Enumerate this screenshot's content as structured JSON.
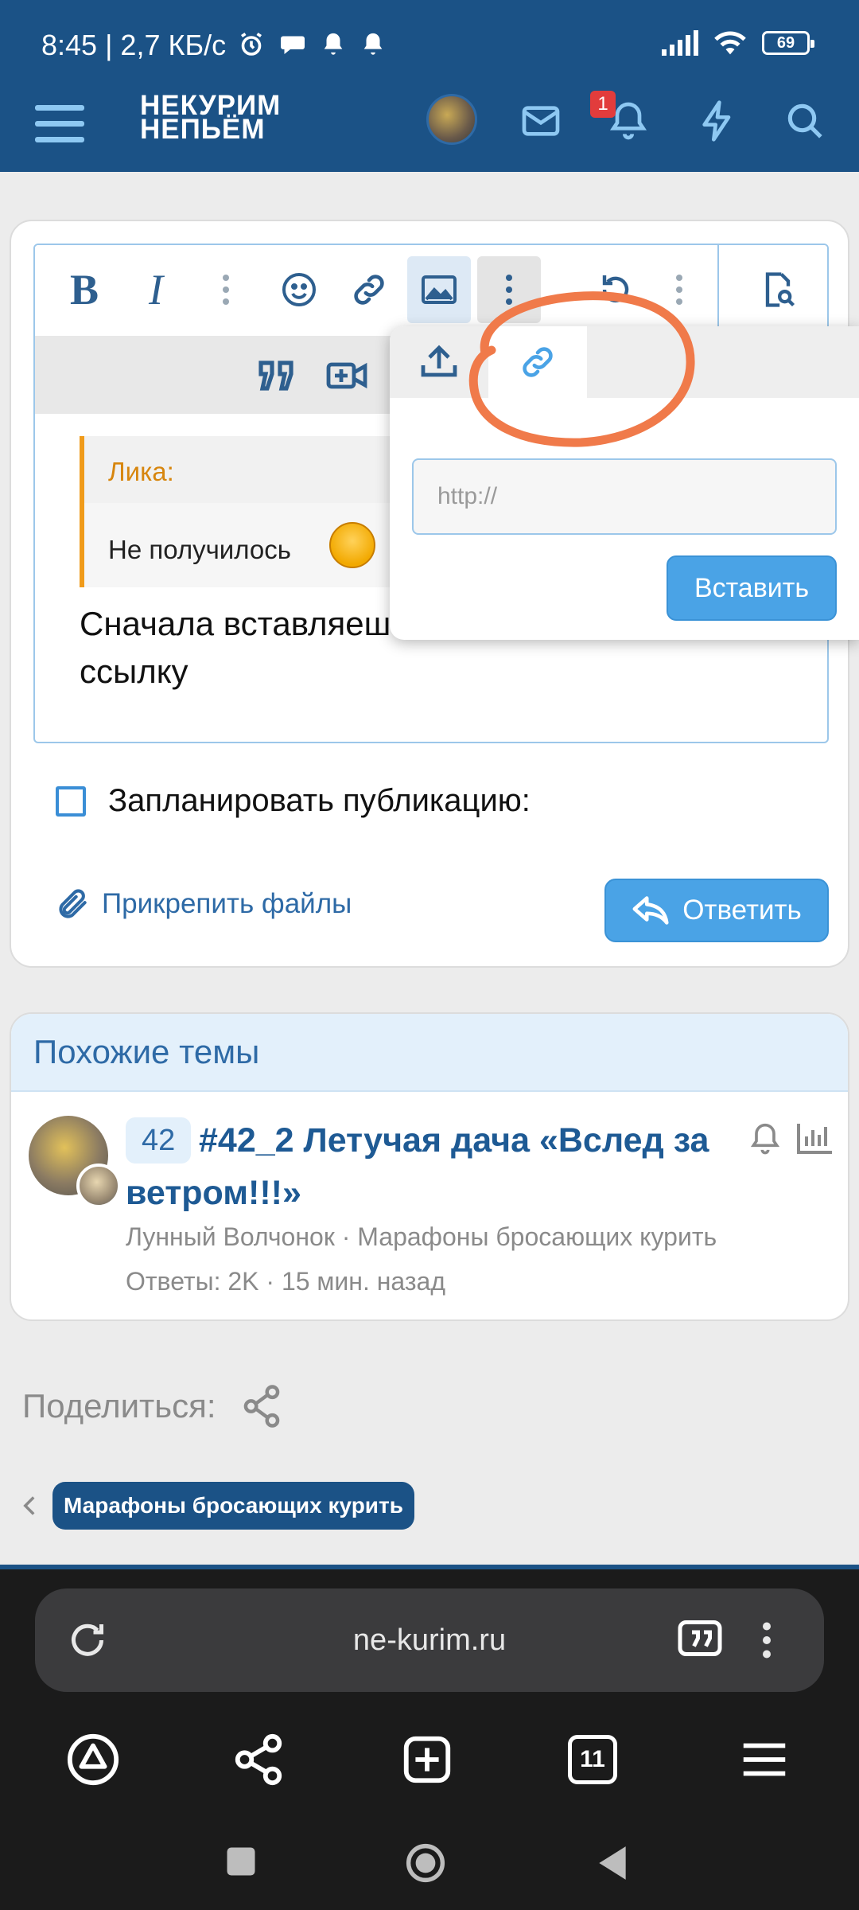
{
  "status_bar": {
    "time_speed": "8:45 | 2,7 КБ/с",
    "battery": "69"
  },
  "header": {
    "logo_line1": "НЕКУРИМ",
    "logo_line2": "НЕПЬЁМ",
    "notification_count": "1",
    "brand_color": "#1b5286"
  },
  "editor": {
    "bold": "B",
    "italic": "I",
    "quote_author": "Лика:",
    "quote_text": "Не получилось",
    "body_text": "Сначала вставляеш\nссылку"
  },
  "popup": {
    "url_placeholder": "http://",
    "insert_label": "Вставить"
  },
  "reply_form": {
    "schedule_label": "Запланировать публикацию:",
    "attach_label": "Прикрепить файлы",
    "reply_label": "Ответить",
    "accent_color": "#4aa3e6"
  },
  "similar": {
    "title": "Похожие темы",
    "thread": {
      "count": "42",
      "title": "#42_2 Летучая дача «Вслед за ветром!!!»",
      "meta": "Лунный Волчонок · Марафоны бросающих курить",
      "replies": "Ответы: 2K · 15 мин. назад"
    }
  },
  "share": {
    "label": "Поделиться:"
  },
  "breadcrumb": {
    "tag": "Марафоны бросающих курить"
  },
  "browser": {
    "url": "ne-kurim.ru",
    "tab_count": "11"
  }
}
